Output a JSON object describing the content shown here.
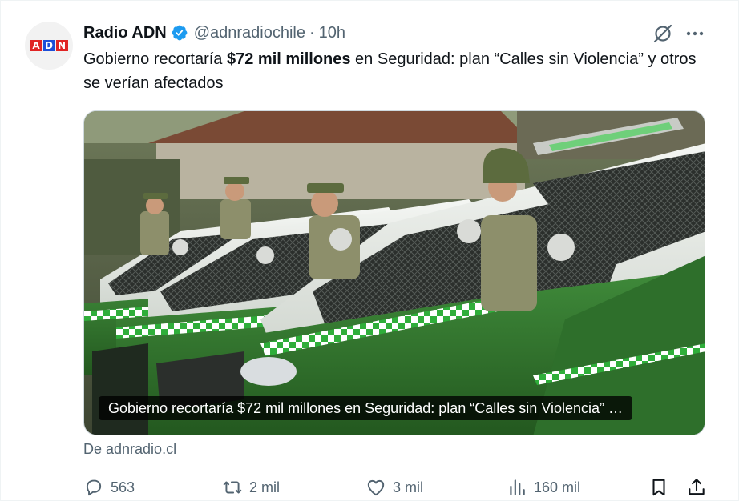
{
  "author": {
    "display_name": "Radio ADN",
    "handle": "@adnradiochile",
    "separator": "·",
    "time": "10h",
    "avatar_letters": [
      "A",
      "D",
      "N"
    ],
    "verified_color": "#1d9bf0"
  },
  "tweet": {
    "text_before": "Gobierno recortaría ",
    "text_bold": "$72 mil millones",
    "text_after": " en Seguridad: plan “Calles sin Violencia” y otros se verían afectados"
  },
  "card": {
    "caption": "Gobierno recortaría $72 mil millones en Seguridad: plan “Calles sin Violencia” …",
    "source": "De adnradio.cl"
  },
  "actions": {
    "replies": "563",
    "reposts": "2 mil",
    "likes": "3 mil",
    "views": "160 mil"
  },
  "icons": {
    "header": [
      "verified-badge-icon",
      "grok-icon",
      "more-options-icon"
    ],
    "actions": [
      "reply-icon",
      "repost-icon",
      "like-icon",
      "views-icon",
      "bookmark-icon",
      "share-icon"
    ]
  },
  "colors": {
    "text": "#0f1419",
    "secondary": "#536471",
    "border": "#cfd9de"
  }
}
